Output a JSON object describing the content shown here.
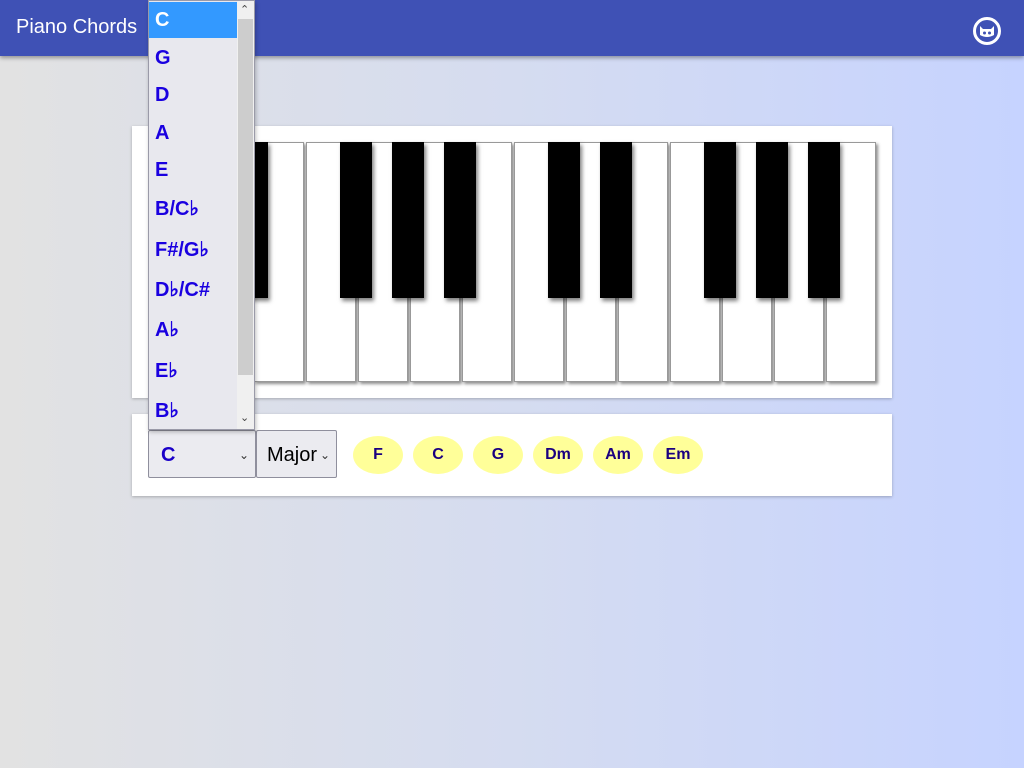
{
  "app": {
    "title": "Piano Chords",
    "github_icon": "github-icon"
  },
  "piano": {
    "white_keys": 14,
    "black_keys": 10
  },
  "controls": {
    "root_value": "C",
    "quality_value": "Major",
    "chords": [
      "F",
      "C",
      "G",
      "Dm",
      "Am",
      "Em"
    ]
  },
  "dropdown": {
    "options": [
      "C",
      "G",
      "D",
      "A",
      "E",
      "B/C♭",
      "F#/G♭",
      "D♭/C#",
      "A♭",
      "E♭",
      "B♭"
    ],
    "selected_index": 0
  },
  "colors": {
    "appbar": "#3f51b5",
    "chord_bg": "#ffff99",
    "chord_text": "#1a0080",
    "option_text": "#1a00e0",
    "selected_bg": "#3399ff"
  }
}
